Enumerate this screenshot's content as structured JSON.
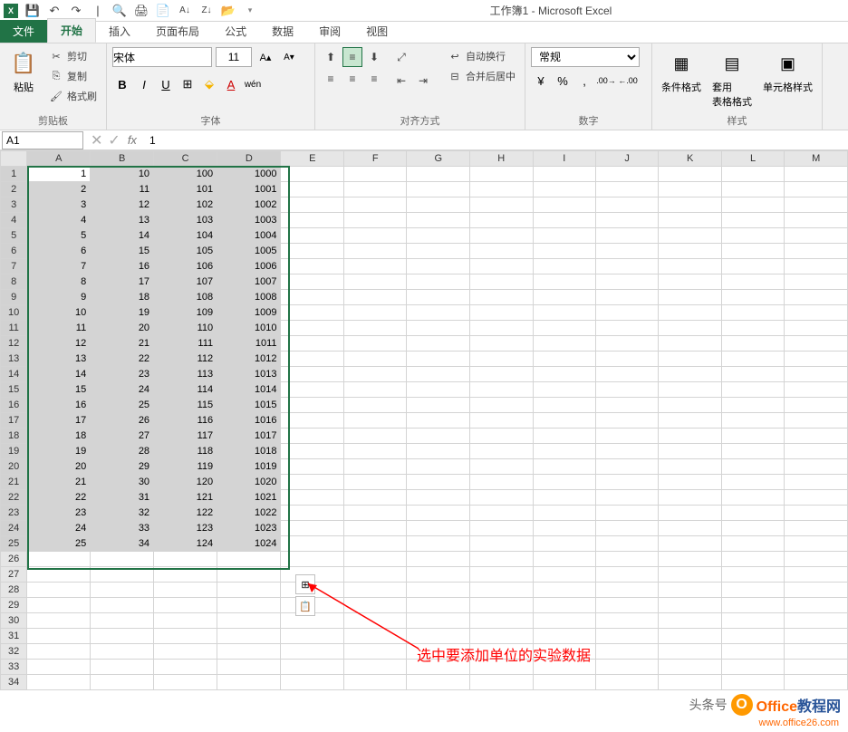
{
  "title": "工作簿1 - Microsoft Excel",
  "qat": {
    "save": "💾",
    "undo": "↶",
    "redo": "↷"
  },
  "tabs": {
    "file": "文件",
    "home": "开始",
    "insert": "插入",
    "layout": "页面布局",
    "formulas": "公式",
    "data": "数据",
    "review": "审阅",
    "view": "视图"
  },
  "ribbon": {
    "clipboard": {
      "label": "剪贴板",
      "paste": "粘贴",
      "cut": "剪切",
      "copy": "复制",
      "format_painter": "格式刷"
    },
    "font": {
      "label": "字体",
      "name": "宋体",
      "size": "11"
    },
    "alignment": {
      "label": "对齐方式",
      "wrap": "自动换行",
      "merge": "合并后居中"
    },
    "number": {
      "label": "数字",
      "format": "常规"
    },
    "styles": {
      "label": "样式",
      "conditional": "条件格式",
      "table": "套用\n表格格式",
      "cell": "单元格样式"
    }
  },
  "formula_bar": {
    "name_box": "A1",
    "formula": "1"
  },
  "columns": [
    "A",
    "B",
    "C",
    "D",
    "E",
    "F",
    "G",
    "H",
    "I",
    "J",
    "K",
    "L",
    "M"
  ],
  "selected_cols": [
    "A",
    "B",
    "C",
    "D"
  ],
  "total_rows": 34,
  "selected_rows": 25,
  "active_cell": {
    "row": 1,
    "col": "A"
  },
  "grid_data": [
    [
      1,
      10,
      100,
      1000
    ],
    [
      2,
      11,
      101,
      1001
    ],
    [
      3,
      12,
      102,
      1002
    ],
    [
      4,
      13,
      103,
      1003
    ],
    [
      5,
      14,
      104,
      1004
    ],
    [
      6,
      15,
      105,
      1005
    ],
    [
      7,
      16,
      106,
      1006
    ],
    [
      8,
      17,
      107,
      1007
    ],
    [
      9,
      18,
      108,
      1008
    ],
    [
      10,
      19,
      109,
      1009
    ],
    [
      11,
      20,
      110,
      1010
    ],
    [
      12,
      21,
      111,
      1011
    ],
    [
      13,
      22,
      112,
      1012
    ],
    [
      14,
      23,
      113,
      1013
    ],
    [
      15,
      24,
      114,
      1014
    ],
    [
      16,
      25,
      115,
      1015
    ],
    [
      17,
      26,
      116,
      1016
    ],
    [
      18,
      27,
      117,
      1017
    ],
    [
      19,
      28,
      118,
      1018
    ],
    [
      20,
      29,
      119,
      1019
    ],
    [
      21,
      30,
      120,
      1020
    ],
    [
      22,
      31,
      121,
      1021
    ],
    [
      23,
      32,
      122,
      1022
    ],
    [
      24,
      33,
      123,
      1023
    ],
    [
      25,
      34,
      124,
      1024
    ]
  ],
  "annotation_text": "选中要添加单位的实验数据",
  "watermark": {
    "text1": "头条号",
    "text2_a": "Office",
    "text2_b": "教程网",
    "url": "www.office26.com"
  }
}
